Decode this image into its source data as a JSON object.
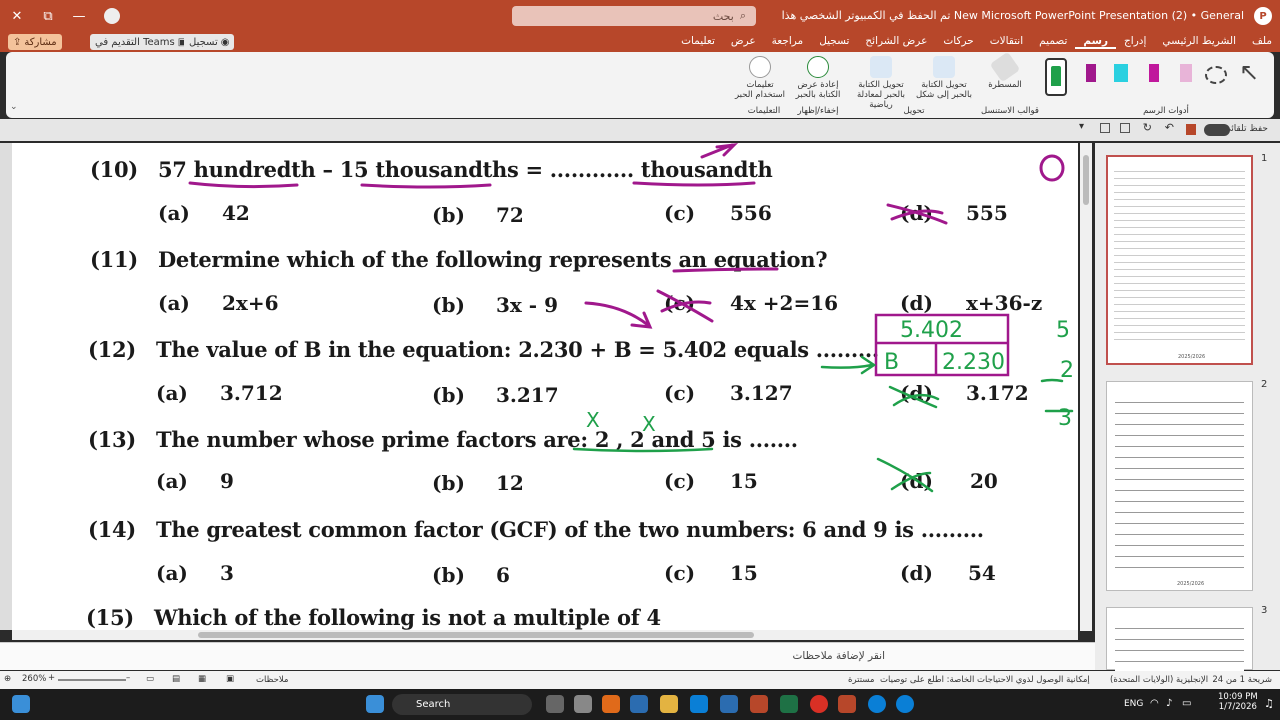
{
  "titlebar": {
    "title": "New Microsoft PowerPoint Presentation (2) • General  تم الحفظ في الكمبيوتر الشخصي هذا",
    "search_placeholder": "بحث",
    "close": "✕",
    "restore": "⧉",
    "minimize": "—"
  },
  "tabs": [
    "ملف",
    "الشريط الرئيسي",
    "إدراج",
    "رسم",
    "تصميم",
    "انتقالات",
    "حركات",
    "عرض الشرائح",
    "تسجيل",
    "مراجعة",
    "عرض",
    "تعليمات"
  ],
  "active_tab": "رسم",
  "actions": {
    "share": "مشاركة",
    "teams": "التقديم في Teams",
    "record": "تسجيل"
  },
  "ribbon": {
    "draw_tools_label": "أدوات الرسم",
    "ruler": "المسطرة",
    "stencils_label": "قوالب الاستنسل",
    "ink_to_shape": "تحويل الكتابة بالحبر إلى شكل",
    "ink_to_math": "تحويل الكتابة بالحبر لمعادلة رياضية",
    "convert_label": "تحويل",
    "replay": "إعادة عرض الكتابة بالحبر",
    "replay_label": "إخفاء/إظهار",
    "help": "تعليمات استخدام الحبر",
    "help_label": "التعليمات"
  },
  "toolbar2": {
    "autosave": "حفظ تلقائي"
  },
  "slide": {
    "q10": {
      "num": "(10)",
      "text": "57 hundredth – 15 thousandths = ............ thousandth",
      "options": [
        [
          "(a)",
          "42"
        ],
        [
          "(b)",
          "72"
        ],
        [
          "(c)",
          "556"
        ],
        [
          "(d)",
          "555"
        ]
      ]
    },
    "q11": {
      "num": "(11)",
      "text": "Determine which of the following represents an equation?",
      "options": [
        [
          "(a)",
          "2x+6"
        ],
        [
          "(b)",
          "3x - 9"
        ],
        [
          "(c)",
          "4x +2=16"
        ],
        [
          "(d)",
          "x+36-z"
        ]
      ]
    },
    "q12": {
      "num": "(12)",
      "text": "The value of B in the equation: 2.230 + B = 5.402 equals .........",
      "options": [
        [
          "(a)",
          "3.712"
        ],
        [
          "(b)",
          "3.217"
        ],
        [
          "(c)",
          "3.127"
        ],
        [
          "(d)",
          "3.172"
        ]
      ]
    },
    "q13": {
      "num": "(13)",
      "text": "The number whose prime factors are: 2 , 2 and 5 is .......",
      "options": [
        [
          "(a)",
          "9"
        ],
        [
          "(b)",
          "12"
        ],
        [
          "(c)",
          "15"
        ],
        [
          "(d)",
          "20"
        ]
      ]
    },
    "q14": {
      "num": "(14)",
      "text": "The greatest common factor (GCF) of the two numbers: 6 and 9 is .........",
      "options": [
        [
          "(a)",
          "3"
        ],
        [
          "(b)",
          "6"
        ],
        [
          "(c)",
          "15"
        ],
        [
          "(d)",
          "54"
        ]
      ]
    },
    "q15": {
      "num": "(15)",
      "text": "Which of the following is not a multiple of 4"
    },
    "ink": {
      "box_top": "5.402",
      "box_b": "B",
      "box_val": "2.230",
      "side": "5 - 2 / 3",
      "zero": "0",
      "x1": "X",
      "x2": "X"
    }
  },
  "notes_placeholder": "انقر لإضافة ملاحظات",
  "thumbs": {
    "n1": "1",
    "n2": "2",
    "n3": "3",
    "year": "2025/2026"
  },
  "status": {
    "zoom": "260%",
    "notes": "ملاحظات",
    "slide_of": "شريحة 1 من 24",
    "language": "الإنجليزية (الولايات المتحدة)",
    "accessibility": "إمكانية الوصول لذوي الاحتياجات الخاصة: اطلع على توصيات",
    "hidden": "مستترة"
  },
  "taskbar": {
    "search": "Search",
    "lang": "ENG",
    "time": "10:09 PM",
    "date": "1/7/2026"
  },
  "colors": {
    "accent": "#b7472a",
    "ink_purple": "#a0188c",
    "ink_green": "#1fa04a"
  }
}
